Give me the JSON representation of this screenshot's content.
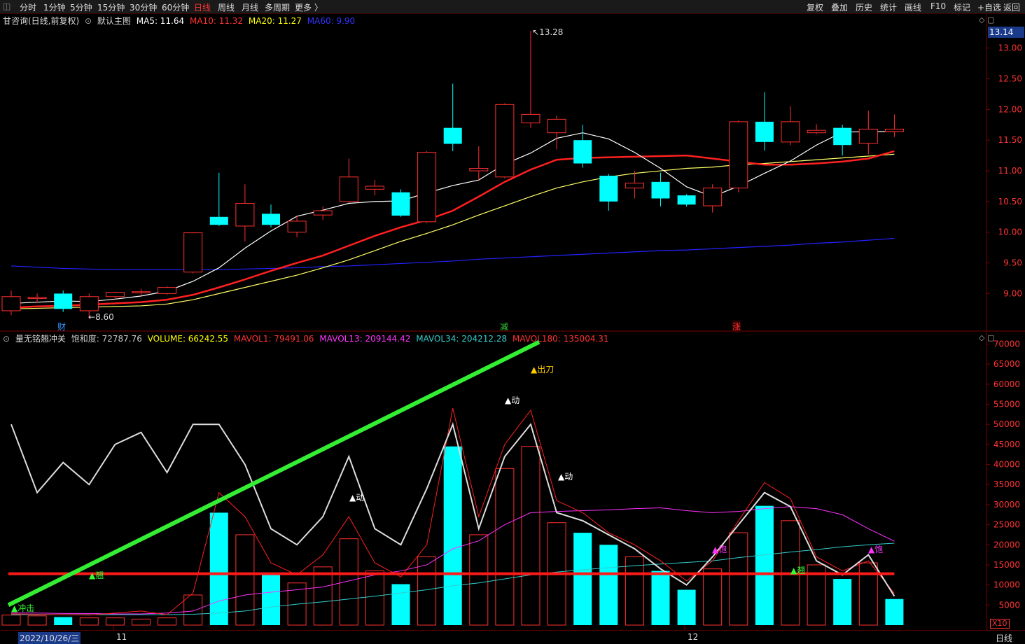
{
  "toolbar": {
    "periods": [
      "分时",
      "1分钟",
      "5分钟",
      "15分钟",
      "30分钟",
      "60分钟",
      "日线",
      "周线",
      "月线",
      "多周期",
      "更多 〉"
    ],
    "active": "日线",
    "right": [
      "复权",
      "叠加",
      "历史",
      "统计",
      "画线",
      "F10",
      "标记",
      "+自选",
      "返回"
    ]
  },
  "main_header": {
    "name": "甘咨询(日线,前复权)",
    "template": "默认主图",
    "ma": [
      {
        "label": "MA5: 11.64",
        "color": "#ffffff"
      },
      {
        "label": "MA10: 11.32",
        "color": "#ff3333"
      },
      {
        "label": "MA20: 11.27",
        "color": "#ffff00"
      },
      {
        "label": "MA60: 9.90",
        "color": "#2222ff"
      }
    ]
  },
  "sub_header": {
    "name": "量无铭翘冲关",
    "items": [
      {
        "label": "饱和度: 72787.76",
        "color": "#c8c8c8"
      },
      {
        "label": "VOLUME: 66242.55",
        "color": "#ffff00"
      },
      {
        "label": "MAVOL1: 79491.06",
        "color": "#ff3333"
      },
      {
        "label": "MAVOL13: 209144.42",
        "color": "#ff33ff"
      },
      {
        "label": "MAVOL34: 204212.28",
        "color": "#33cccc"
      },
      {
        "label": "MAVOL180: 135004.31",
        "color": "#ff3333"
      }
    ]
  },
  "price_axis_label": "13.14",
  "annotations": {
    "high": "13.28",
    "low": "8.60"
  },
  "markers": [
    {
      "text": "财",
      "color": "#3399ff"
    },
    {
      "text": "减",
      "color": "#33cc33"
    },
    {
      "text": "涨",
      "color": "#ff3333"
    }
  ],
  "signals": {
    "chudao": "▲出刀",
    "dong": "▲动",
    "qiao": "▲翘",
    "chongji": "冲击",
    "bao": "▲饱"
  },
  "x_axis": {
    "date": "2022/10/26/三",
    "m11": "11",
    "m12": "12"
  },
  "unit": "X10",
  "period_label": "日线",
  "colors": {
    "up": "#ff3030",
    "down": "#00ffff"
  },
  "chart_data": [
    {
      "type": "candlestick",
      "ylim": [
        8.4,
        13.35
      ],
      "yticks": [
        9.0,
        9.5,
        10.0,
        10.5,
        11.0,
        11.5,
        12.0,
        12.5,
        13.0
      ],
      "candles": [
        {
          "o": 8.72,
          "c": 8.95,
          "h": 9.05,
          "l": 8.65
        },
        {
          "o": 8.92,
          "c": 8.94,
          "h": 9.0,
          "l": 8.85
        },
        {
          "o": 9.0,
          "c": 8.75,
          "h": 9.05,
          "l": 8.7
        },
        {
          "o": 8.72,
          "c": 8.95,
          "h": 9.0,
          "l": 8.6
        },
        {
          "o": 8.95,
          "c": 9.02,
          "h": 9.03,
          "l": 8.9
        },
        {
          "o": 9.02,
          "c": 9.03,
          "h": 9.08,
          "l": 8.98
        },
        {
          "o": 9.0,
          "c": 9.1,
          "h": 9.12,
          "l": 8.98
        },
        {
          "o": 9.35,
          "c": 9.99,
          "h": 10.0,
          "l": 9.33
        },
        {
          "o": 10.25,
          "c": 10.12,
          "h": 10.97,
          "l": 10.1
        },
        {
          "o": 10.1,
          "c": 10.47,
          "h": 10.78,
          "l": 9.85
        },
        {
          "o": 10.3,
          "c": 10.12,
          "h": 10.45,
          "l": 10.08
        },
        {
          "o": 10.0,
          "c": 10.18,
          "h": 10.27,
          "l": 9.92
        },
        {
          "o": 10.28,
          "c": 10.35,
          "h": 10.42,
          "l": 10.2
        },
        {
          "o": 10.5,
          "c": 10.9,
          "h": 11.2,
          "l": 10.48
        },
        {
          "o": 10.7,
          "c": 10.75,
          "h": 10.85,
          "l": 10.6
        },
        {
          "o": 10.65,
          "c": 10.27,
          "h": 10.7,
          "l": 10.25
        },
        {
          "o": 10.17,
          "c": 11.3,
          "h": 11.32,
          "l": 10.15
        },
        {
          "o": 11.7,
          "c": 11.44,
          "h": 12.42,
          "l": 11.32
        },
        {
          "o": 11.0,
          "c": 11.04,
          "h": 11.4,
          "l": 10.85
        },
        {
          "o": 10.9,
          "c": 12.08,
          "h": 12.1,
          "l": 10.88
        },
        {
          "o": 11.78,
          "c": 11.92,
          "h": 13.28,
          "l": 11.7
        },
        {
          "o": 11.62,
          "c": 11.84,
          "h": 11.9,
          "l": 11.35
        },
        {
          "o": 11.5,
          "c": 11.12,
          "h": 11.75,
          "l": 11.05
        },
        {
          "o": 10.92,
          "c": 10.5,
          "h": 10.95,
          "l": 10.35
        },
        {
          "o": 10.72,
          "c": 10.8,
          "h": 11.0,
          "l": 10.55
        },
        {
          "o": 10.82,
          "c": 10.55,
          "h": 10.97,
          "l": 10.42
        },
        {
          "o": 10.6,
          "c": 10.45,
          "h": 10.62,
          "l": 10.42
        },
        {
          "o": 10.43,
          "c": 10.72,
          "h": 10.78,
          "l": 10.32
        },
        {
          "o": 10.72,
          "c": 11.8,
          "h": 11.82,
          "l": 10.65
        },
        {
          "o": 11.8,
          "c": 11.47,
          "h": 12.28,
          "l": 11.33
        },
        {
          "o": 11.47,
          "c": 11.8,
          "h": 12.05,
          "l": 11.42
        },
        {
          "o": 11.62,
          "c": 11.66,
          "h": 11.76,
          "l": 11.6
        },
        {
          "o": 11.7,
          "c": 11.42,
          "h": 11.75,
          "l": 11.25
        },
        {
          "o": 11.45,
          "c": 11.68,
          "h": 11.98,
          "l": 11.27
        },
        {
          "o": 11.64,
          "c": 11.68,
          "h": 11.92,
          "l": 11.55
        }
      ],
      "ma5": [
        8.84,
        8.86,
        8.88,
        8.87,
        8.91,
        8.96,
        9.04,
        9.2,
        9.42,
        9.74,
        10.02,
        10.26,
        10.36,
        10.47,
        10.5,
        10.51,
        10.64,
        10.76,
        10.85,
        11.11,
        11.29,
        11.53,
        11.62,
        11.52,
        11.3,
        11.04,
        10.74,
        10.58,
        10.75,
        10.96,
        11.16,
        11.42,
        11.63,
        11.64,
        11.64
      ],
      "ma10": [
        8.77,
        8.79,
        8.8,
        8.82,
        8.84,
        8.86,
        8.9,
        8.98,
        9.1,
        9.23,
        9.37,
        9.5,
        9.62,
        9.78,
        9.94,
        10.08,
        10.2,
        10.35,
        10.58,
        10.82,
        11.02,
        11.18,
        11.21,
        11.22,
        11.23,
        11.24,
        11.25,
        11.2,
        11.15,
        11.1,
        11.1,
        11.12,
        11.15,
        11.2,
        11.32
      ],
      "ma20": [
        8.75,
        8.76,
        8.77,
        8.78,
        8.79,
        8.8,
        8.83,
        8.9,
        9.0,
        9.1,
        9.2,
        9.3,
        9.42,
        9.55,
        9.7,
        9.85,
        9.98,
        10.12,
        10.28,
        10.43,
        10.58,
        10.72,
        10.82,
        10.9,
        10.96,
        11.0,
        11.04,
        11.06,
        11.1,
        11.12,
        11.15,
        11.18,
        11.21,
        11.24,
        11.27
      ],
      "ma60": [
        9.45,
        9.43,
        9.41,
        9.4,
        9.39,
        9.39,
        9.39,
        9.39,
        9.39,
        9.4,
        9.41,
        9.42,
        9.44,
        9.45,
        9.47,
        9.49,
        9.51,
        9.53,
        9.56,
        9.58,
        9.6,
        9.62,
        9.64,
        9.66,
        9.68,
        9.7,
        9.71,
        9.73,
        9.75,
        9.77,
        9.79,
        9.82,
        9.84,
        9.87,
        9.9
      ]
    },
    {
      "type": "bar",
      "ylim": [
        0,
        72000
      ],
      "yticks": [
        5000,
        10000,
        15000,
        20000,
        25000,
        30000,
        35000,
        40000,
        45000,
        50000,
        55000,
        60000,
        65000,
        70000
      ],
      "volume": [
        2500,
        2300,
        2000,
        1800,
        1800,
        1500,
        1800,
        7500,
        28000,
        22500,
        13000,
        10500,
        14500,
        21500,
        13500,
        10200,
        17000,
        44500,
        22500,
        39000,
        44500,
        25500,
        23000,
        20000,
        17000,
        13500,
        8800,
        14000,
        23000,
        29700,
        26000,
        15000,
        11500,
        15500,
        6500
      ],
      "vol_up": [
        true,
        true,
        false,
        true,
        true,
        true,
        true,
        true,
        false,
        true,
        false,
        true,
        true,
        true,
        true,
        false,
        true,
        false,
        true,
        true,
        true,
        true,
        false,
        false,
        true,
        false,
        false,
        true,
        true,
        false,
        true,
        true,
        false,
        true,
        false
      ],
      "saturation": [
        50000,
        33000,
        40500,
        35000,
        45000,
        48000,
        38000,
        50000,
        50000,
        40000,
        24000,
        20000,
        27000,
        42000,
        24000,
        20000,
        34000,
        50000,
        24000,
        42000,
        50000,
        28000,
        26000,
        22500,
        19000,
        14000,
        10000,
        17000,
        25000,
        33000,
        29500,
        16000,
        12500,
        17500,
        7200
      ],
      "mavol_red": [
        2800,
        2700,
        2600,
        2500,
        3000,
        3500,
        2600,
        8000,
        33000,
        27000,
        15500,
        12500,
        17500,
        27000,
        15500,
        12000,
        20000,
        54000,
        27000,
        45000,
        53500,
        31000,
        28000,
        23000,
        20000,
        16000,
        11000,
        16000,
        26000,
        35500,
        31500,
        17000,
        13500,
        16000,
        7900
      ],
      "mavol13": [
        3000,
        3000,
        2900,
        2900,
        2800,
        2800,
        3000,
        3500,
        6000,
        7500,
        8200,
        8800,
        9500,
        11000,
        12500,
        13500,
        15000,
        19000,
        21000,
        25000,
        28000,
        28300,
        28500,
        28700,
        29000,
        29200,
        28500,
        28000,
        28300,
        29000,
        29500,
        29000,
        27500,
        24000,
        20900
      ],
      "mavol34": [
        2600,
        2600,
        2600,
        2600,
        2600,
        2600,
        2600,
        2700,
        3000,
        3500,
        4500,
        5200,
        5800,
        6500,
        7200,
        8000,
        8800,
        9800,
        10500,
        11500,
        12500,
        13200,
        13800,
        14300,
        14800,
        15200,
        15600,
        16000,
        16800,
        17500,
        18200,
        18800,
        19500,
        20000,
        20400
      ],
      "mavol180": 12800
    }
  ]
}
